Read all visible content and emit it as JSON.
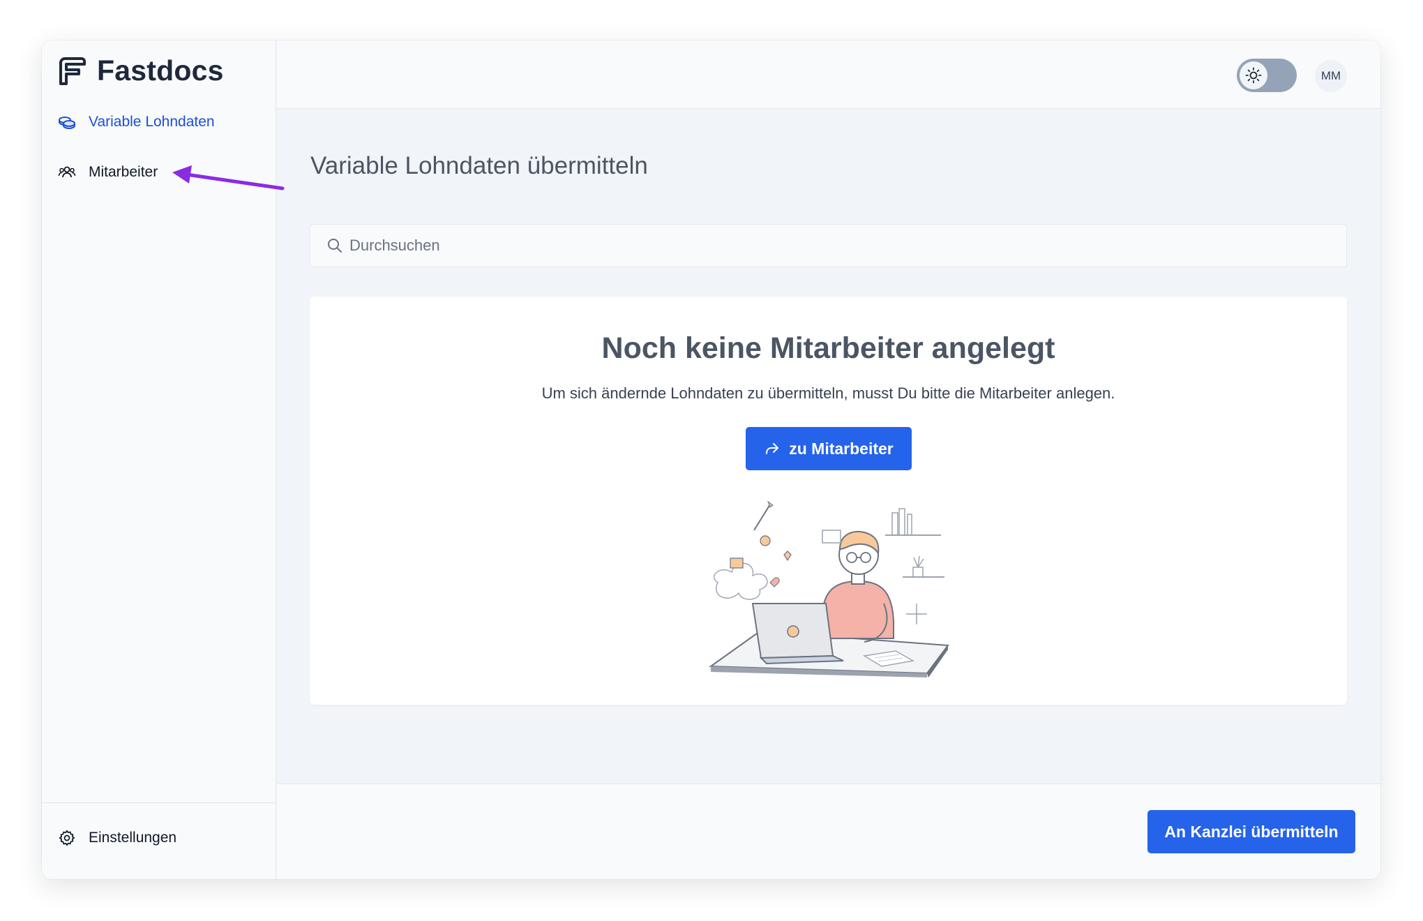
{
  "brand": {
    "name": "Fastdocs"
  },
  "sidebar": {
    "items": [
      {
        "label": "Variable Lohndaten",
        "icon": "coins-icon",
        "active": true
      },
      {
        "label": "Mitarbeiter",
        "icon": "users-icon",
        "active": false
      }
    ],
    "settings_label": "Einstellungen"
  },
  "header": {
    "theme_toggle": {
      "state": "light",
      "icon": "sun-icon"
    },
    "avatar_initials": "MM"
  },
  "main": {
    "title": "Variable Lohndaten übermitteln",
    "search": {
      "placeholder": "Durchsuchen",
      "value": ""
    },
    "empty_state": {
      "title": "Noch keine Mitarbeiter angelegt",
      "subtitle": "Um sich ändernde Lohndaten zu übermitteln, musst Du bitte die Mitarbeiter anlegen.",
      "button_label": "zu Mitarbeiter",
      "button_icon": "share-arrow-icon",
      "illustration": "person-at-laptop-illustration"
    }
  },
  "footer": {
    "submit_label": "An Kanzlei übermitteln"
  },
  "colors": {
    "accent": "#2563eb",
    "active_nav": "#1d4ed8",
    "annotation": "#8b2be2",
    "background": "#f1f4f8"
  }
}
